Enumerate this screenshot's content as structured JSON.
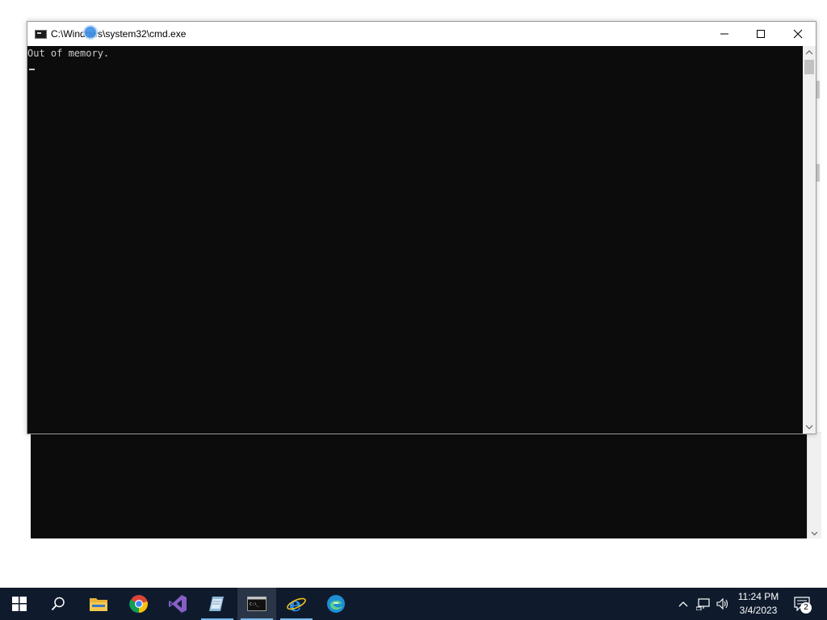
{
  "window": {
    "title": "C:\\Windows\\system32\\cmd.exe",
    "console_lines": [
      "Out of memory."
    ]
  },
  "taskbar": {
    "items": [
      {
        "name": "start-button",
        "icon": "windows-logo-icon"
      },
      {
        "name": "search-button",
        "icon": "search-icon"
      },
      {
        "name": "file-explorer",
        "icon": "folder-icon"
      },
      {
        "name": "chrome",
        "icon": "chrome-icon"
      },
      {
        "name": "visual-studio",
        "icon": "visual-studio-icon"
      },
      {
        "name": "notepad-app",
        "icon": "notepad-icon"
      },
      {
        "name": "cmd",
        "icon": "cmd-icon"
      },
      {
        "name": "internet-explorer",
        "icon": "ie-icon"
      },
      {
        "name": "edge",
        "icon": "edge-icon"
      }
    ],
    "clock": {
      "time": "11:24 PM",
      "date": "3/4/2023"
    },
    "notification_count": "2"
  },
  "colors": {
    "console_bg": "#0c0c0c",
    "console_text": "#cccccc",
    "taskbar_bg": "#0f1b2d",
    "accent": "#76b9ed"
  }
}
